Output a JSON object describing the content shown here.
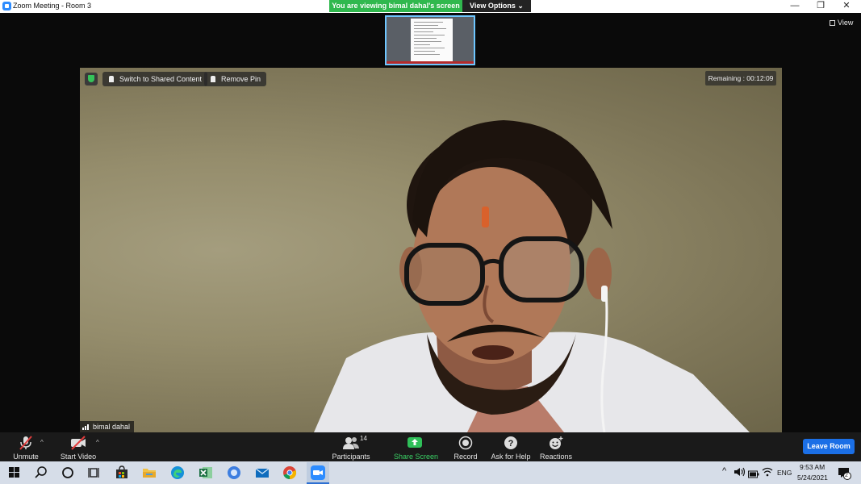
{
  "window": {
    "title": "Zoom Meeting - Room 3",
    "controls": {
      "minimize": "—",
      "restore": "❐",
      "close": "✕"
    }
  },
  "share_banner": {
    "viewing_text": "You are viewing bimal dahal's screen",
    "options_label": "View Options",
    "options_caret": "⌄"
  },
  "view_button": {
    "label": "View"
  },
  "video_overlay": {
    "switch_label": "Switch to Shared Content",
    "remove_pin_label": "Remove Pin",
    "remaining_text": "Remaining : 00:12:09",
    "participant_name": "bimal dahal"
  },
  "toolbar": {
    "unmute": "Unmute",
    "start_video": "Start Video",
    "caret": "^",
    "participants": "Participants",
    "participants_count": "14",
    "share_screen": "Share Screen",
    "record": "Record",
    "ask_for_help": "Ask for Help",
    "reactions": "Reactions",
    "leave_room": "Leave Room"
  },
  "taskbar": {
    "language": "ENG",
    "time": "9:53 AM",
    "date": "5/24/2021",
    "notification_count": "2",
    "tray_caret": "^"
  },
  "colors": {
    "share_green": "#30b84e",
    "leave_blue": "#1b6fe6",
    "taskbar": "#d6dde8"
  }
}
